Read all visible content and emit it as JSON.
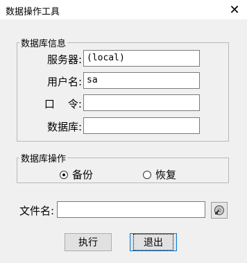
{
  "window": {
    "title": "数据操作工具",
    "close_label": "✕"
  },
  "db_info": {
    "legend": "数据库信息",
    "fields": [
      {
        "label": "服务器:",
        "value": "(local)"
      },
      {
        "label": "用户名:",
        "value": "sa"
      },
      {
        "label": "口    令:",
        "value": ""
      },
      {
        "label": "数据库:",
        "value": ""
      }
    ]
  },
  "db_ops": {
    "legend": "数据库操作",
    "options": [
      {
        "label": "备份",
        "checked": true
      },
      {
        "label": "恢复",
        "checked": false
      }
    ]
  },
  "file": {
    "label": "文件名:",
    "value": "",
    "browse_icon": "disk-browse-icon"
  },
  "buttons": {
    "execute": "执行",
    "exit": "退出"
  }
}
